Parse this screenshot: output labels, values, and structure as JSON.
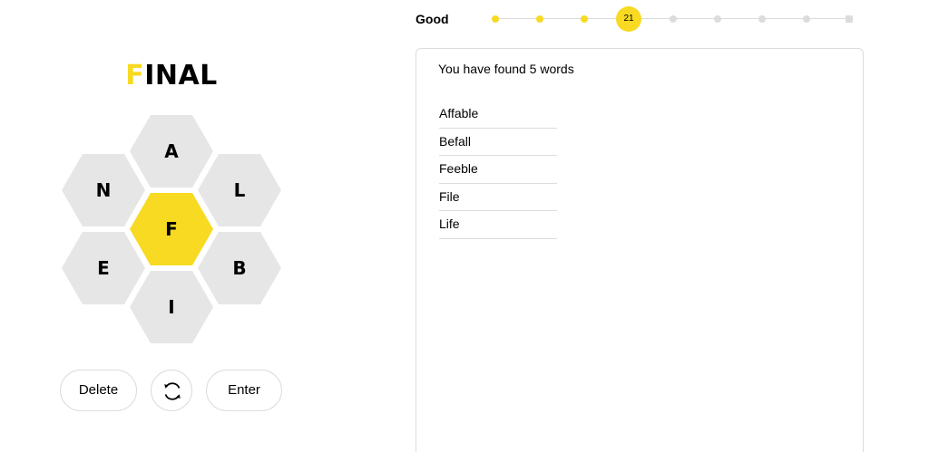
{
  "input": {
    "center_part": "F",
    "rest_part": "INAL"
  },
  "hive": {
    "center_letter": "F",
    "outer_letters": {
      "top": "A",
      "upper_left": "N",
      "upper_right": "L",
      "lower_left": "E",
      "lower_right": "B",
      "bottom": "I"
    }
  },
  "controls": {
    "delete_label": "Delete",
    "shuffle_icon": "shuffle-icon",
    "enter_label": "Enter"
  },
  "progress": {
    "rank": "Good",
    "score": "21",
    "levels_total": 9,
    "current_level": 4,
    "colors": {
      "reached": "#f7da21",
      "unreached": "#dcdcdc"
    }
  },
  "wordlist": {
    "heading": "You have found 5 words",
    "words": [
      "Affable",
      "Befall",
      "Feeble",
      "File",
      "Life"
    ]
  },
  "colors": {
    "accent": "#f7da21",
    "cell": "#e6e6e6",
    "border": "#dcdcdc"
  }
}
